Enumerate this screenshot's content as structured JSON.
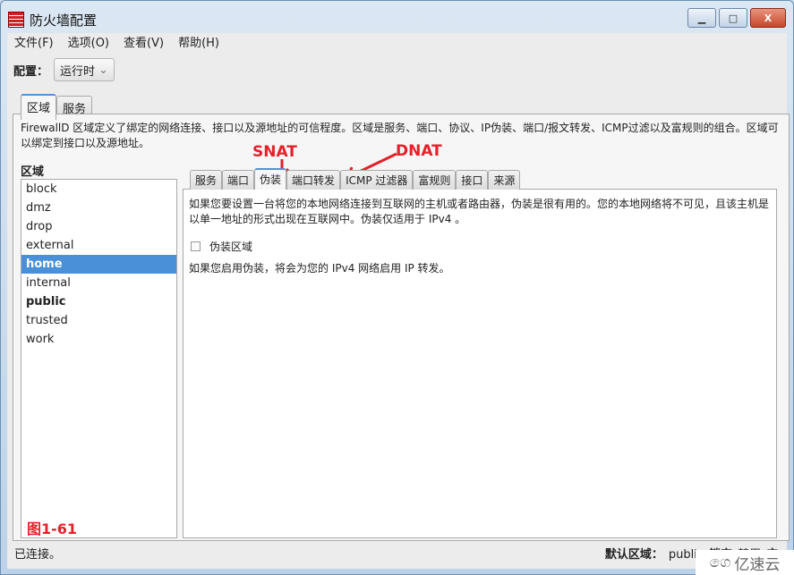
{
  "window": {
    "title": "防火墙配置",
    "minimize": "▁",
    "maximize": "□",
    "close": "X"
  },
  "menu": [
    "文件(F)",
    "选项(O)",
    "查看(V)",
    "帮助(H)"
  ],
  "config": {
    "label": "配置：",
    "value": "运行时"
  },
  "outer_tabs": [
    "区域",
    "服务"
  ],
  "description": "FirewallD 区域定义了绑定的网络连接、接口以及源地址的可信程度。区域是服务、端口、协议、IP伪装、端口/报文转发、ICMP过滤以及富规则的组合。区域可以绑定到接口以及源地址。",
  "zones": {
    "label": "区域",
    "items": [
      "block",
      "dmz",
      "drop",
      "external",
      "home",
      "internal",
      "public",
      "trusted",
      "work"
    ],
    "selected": "home",
    "default": "public"
  },
  "inner_tabs": [
    "服务",
    "端口",
    "伪装",
    "端口转发",
    "ICMP 过滤器",
    "富规则",
    "接口",
    "来源"
  ],
  "inner_active": "伪装",
  "masquerade": {
    "intro": "如果您要设置一台将您的本地网络连接到互联网的主机或者路由器，伪装是很有用的。您的本地网络将不可见，且该主机是以单一地址的形式出现在互联网中。伪装仅适用于 IPv4 。",
    "checkbox": "伪装区域",
    "checked": false,
    "note": "如果您启用伪装，将会为您的 IPv4 网络启用 IP 转发。"
  },
  "status": {
    "left": "已连接。",
    "default_zone_label": "默认区域：",
    "default_zone": "public",
    "lock_label": "锁定",
    "lock_value": "禁用",
    "trail": "应"
  },
  "annotations": {
    "snat": "SNAT",
    "dnat": "DNAT",
    "figure": "图1-61",
    "color": "#e4212a"
  },
  "watermark": "亿速云"
}
